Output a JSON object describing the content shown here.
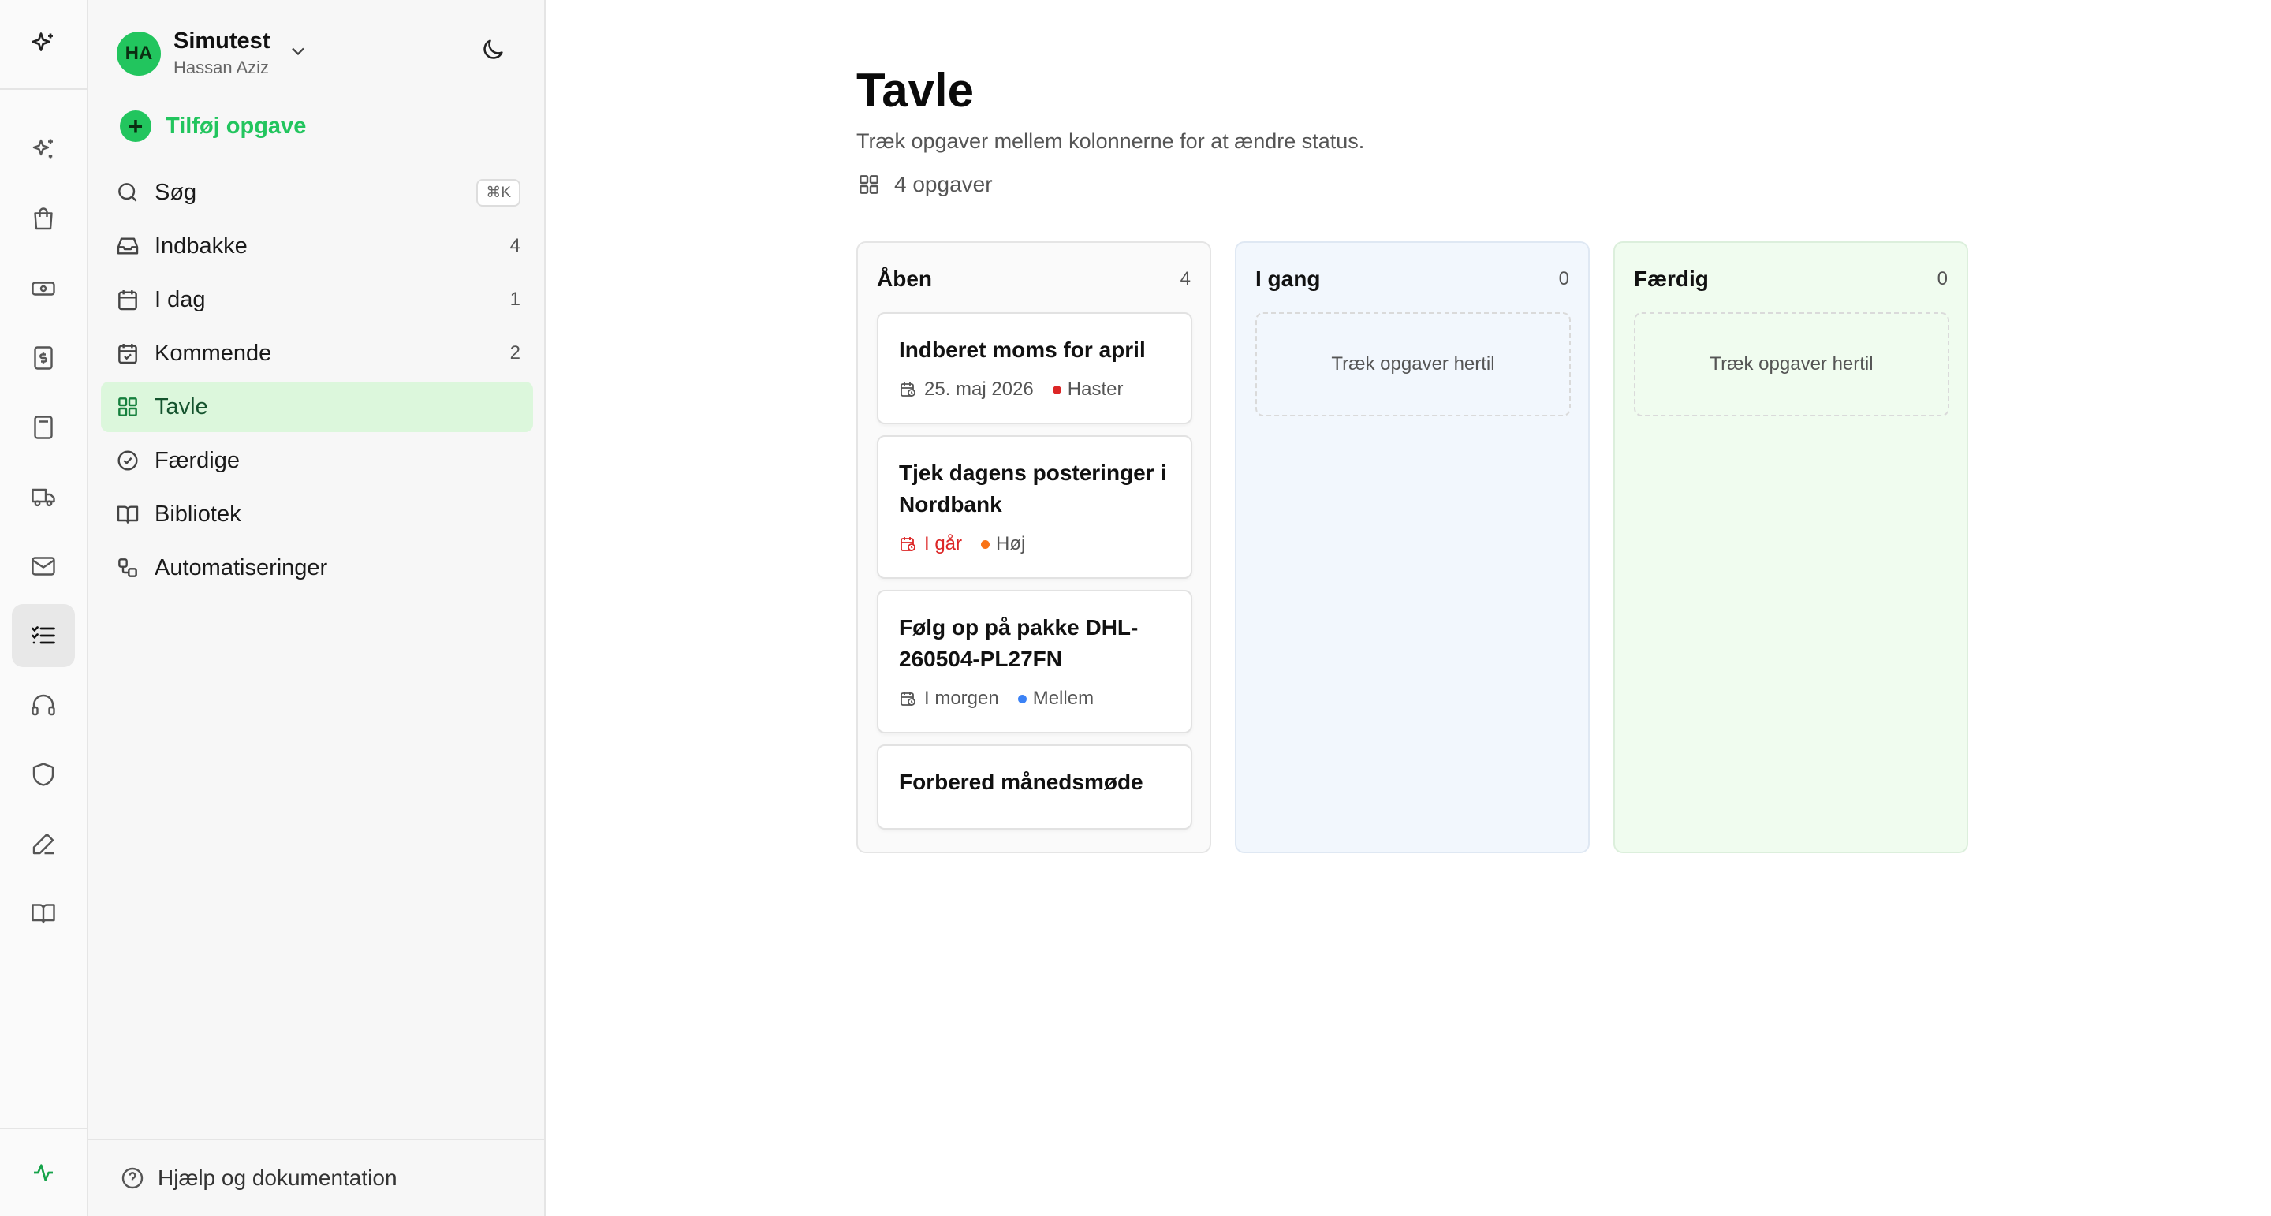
{
  "workspace": {
    "initials": "HA",
    "name": "Simutest",
    "user": "Hassan Aziz"
  },
  "sidebar": {
    "add_task": "Tilføj opgave",
    "search": {
      "label": "Søg",
      "shortcut": "⌘K"
    },
    "items": [
      {
        "label": "Indbakke",
        "count": "4",
        "icon": "inbox-icon"
      },
      {
        "label": "I dag",
        "count": "1",
        "icon": "calendar-icon"
      },
      {
        "label": "Kommende",
        "count": "2",
        "icon": "calendar-check-icon"
      },
      {
        "label": "Tavle",
        "count": "",
        "icon": "grid-icon",
        "active": true
      },
      {
        "label": "Færdige",
        "count": "",
        "icon": "check-circle-icon"
      },
      {
        "label": "Bibliotek",
        "count": "",
        "icon": "book-icon"
      },
      {
        "label": "Automatiseringer",
        "count": "",
        "icon": "workflow-icon"
      }
    ],
    "help": "Hjælp og dokumentation"
  },
  "rail": {
    "items": [
      "sparkles-icon",
      "shopping-bag-icon",
      "banknote-icon",
      "dollar-icon",
      "calculator-icon",
      "truck-icon",
      "mail-icon",
      "tasks-icon",
      "headphones-icon",
      "shield-icon",
      "pen-icon",
      "book-icon"
    ],
    "active": "tasks-icon"
  },
  "page": {
    "title": "Tavle",
    "subtitle": "Træk opgaver mellem kolonnerne for at ændre status.",
    "task_count": "4 opgaver"
  },
  "columns": [
    {
      "title": "Åben",
      "count": "4",
      "cards": [
        {
          "title": "Indberet moms for april",
          "date": "25. maj 2026",
          "overdue": false,
          "priority": "Haster",
          "priority_color": "#dc2626"
        },
        {
          "title": "Tjek dagens posteringer i Nordbank",
          "date": "I går",
          "overdue": true,
          "priority": "Høj",
          "priority_color": "#f97316"
        },
        {
          "title": "Følg op på pakke DHL-260504-PL27FN",
          "date": "I morgen",
          "overdue": false,
          "priority": "Mellem",
          "priority_color": "#3b82f6"
        },
        {
          "title": "Forbered månedsmøde"
        }
      ]
    },
    {
      "title": "I gang",
      "count": "0",
      "empty": "Træk opgaver hertil"
    },
    {
      "title": "Færdig",
      "count": "0",
      "empty": "Træk opgaver hertil"
    }
  ],
  "colors": {
    "accent": "#22c55e",
    "active_bg": "#dcf7dc",
    "urgent": "#dc2626",
    "high": "#f97316",
    "medium": "#3b82f6"
  }
}
